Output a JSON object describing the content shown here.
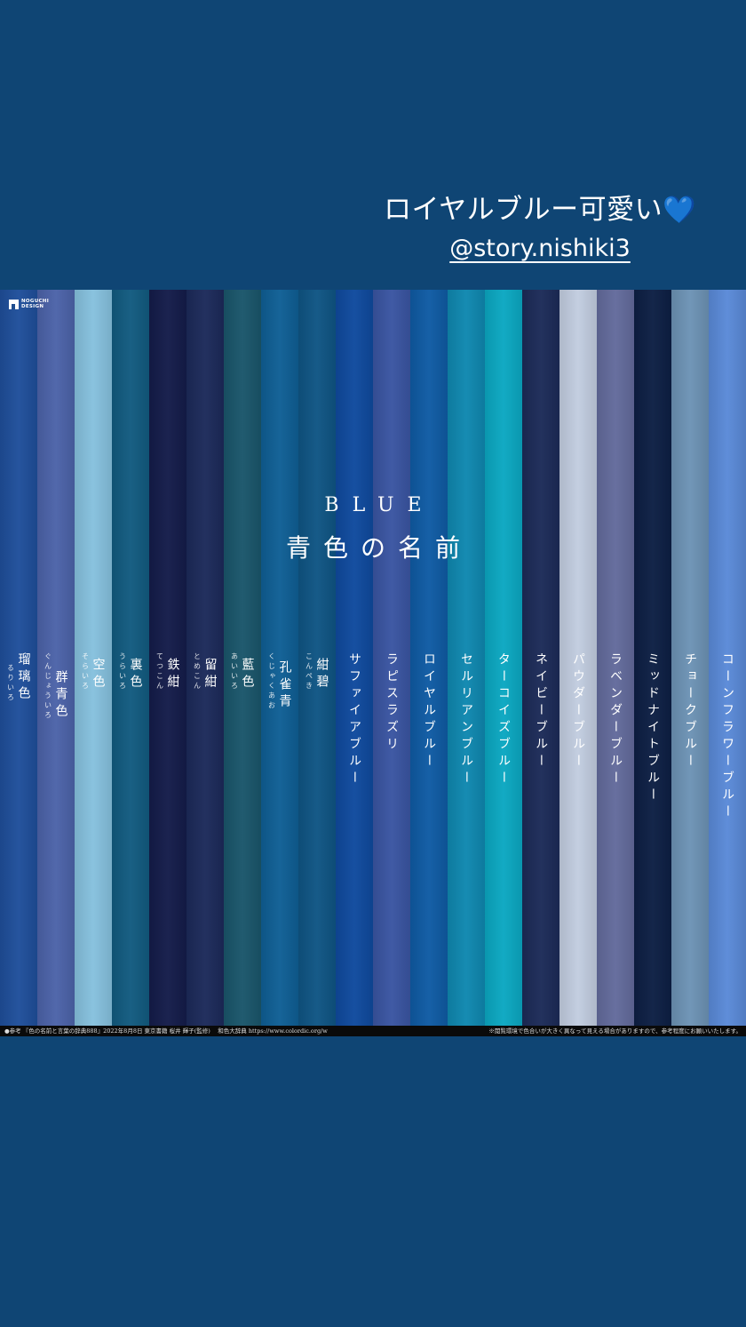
{
  "caption": {
    "text": "ロイヤルブルー可愛い",
    "heart": "💙",
    "mention": "@story.nishiki3"
  },
  "logo": {
    "text": "NOGUCHI DESIGN"
  },
  "heading": {
    "en": "BLUE",
    "ja": "青色の名前"
  },
  "colors": [
    {
      "name": "瑠璃色",
      "kana": "るりいろ",
      "hex": "#1f4f9b"
    },
    {
      "name": "群青色",
      "kana": "ぐんじょういろ",
      "hex": "#4c63a9"
    },
    {
      "name": "空色",
      "kana": "そらいろ",
      "hex": "#86c1de"
    },
    {
      "name": "裏色",
      "kana": "うらいろ",
      "hex": "#125b80"
    },
    {
      "name": "鉄紺",
      "kana": "てつこん",
      "hex": "#141c4a"
    },
    {
      "name": "留紺",
      "kana": "とめこん",
      "hex": "#1c2a5a"
    },
    {
      "name": "藍色",
      "kana": "あいいろ",
      "hex": "#1a566b"
    },
    {
      "name": "孔雀青",
      "kana": "くじゃくあお",
      "hex": "#0f5f95"
    },
    {
      "name": "紺碧",
      "kana": "こんぺき",
      "hex": "#0f5584"
    },
    {
      "name": "サファイアブルー",
      "kana": "",
      "hex": "#0f4a9e"
    },
    {
      "name": "ラピスラズリ",
      "kana": "",
      "hex": "#3a55a2"
    },
    {
      "name": "ロイヤルブルー",
      "kana": "",
      "hex": "#0f5ba4"
    },
    {
      "name": "セルリアンブルー",
      "kana": "",
      "hex": "#0f88b0"
    },
    {
      "name": "ターコイズブルー",
      "kana": "",
      "hex": "#0ba8c2"
    },
    {
      "name": "ネイビーブルー",
      "kana": "",
      "hex": "#1c2b58"
    },
    {
      "name": "パウダーブルー",
      "kana": "",
      "hex": "#c2cde0"
    },
    {
      "name": "ラベンダーブルー",
      "kana": "",
      "hex": "#636b9c"
    },
    {
      "name": "ミッドナイトブルー",
      "kana": "",
      "hex": "#0d1f44"
    },
    {
      "name": "チョークブルー",
      "kana": "",
      "hex": "#6d93b5"
    },
    {
      "name": "コーンフラワーブルー",
      "kana": "",
      "hex": "#5a8ad8"
    }
  ],
  "footer": {
    "left": "●参考 『色の名前と言葉の辞典888』2022年8月8日 東京書籍 桜井 輝子(監修) 　和色大辞典 https://www.colordic.org/w",
    "right": "※閲覧環境で色合いが大きく異なって見える場合がありますので、参考程度にお願いいたします。"
  }
}
